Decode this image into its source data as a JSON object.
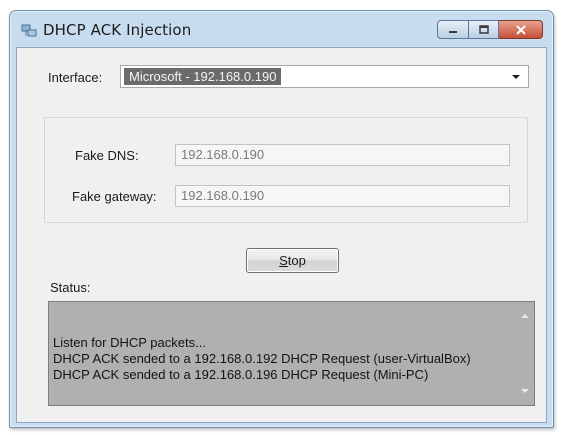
{
  "window": {
    "title": "DHCP ACK Injection",
    "icon": "network-app-icon"
  },
  "interface": {
    "label": "Interface:",
    "selected_value": "Microsoft - 192.168.0.190"
  },
  "fields": {
    "dns_label": "Fake DNS:",
    "dns_value": "192.168.0.190",
    "gateway_label": "Fake gateway:",
    "gateway_value": "192.168.0.190"
  },
  "actions": {
    "stop_label_underlined": "S",
    "stop_label_rest": "top"
  },
  "status": {
    "label": "Status:",
    "lines": [
      "Listen for DHCP packets...",
      "DHCP ACK sended to a 192.168.0.192 DHCP Request (user-VirtualBox)",
      "DHCP ACK sended to a 192.168.0.196 DHCP Request (Mini-PC)"
    ]
  },
  "colors": {
    "window_frame": "#c7dcef",
    "client_bg": "#f0f0f0",
    "selection_bg": "#6b6b6b",
    "status_bg": "#b0b0b0",
    "close_button": "#c74f37"
  }
}
